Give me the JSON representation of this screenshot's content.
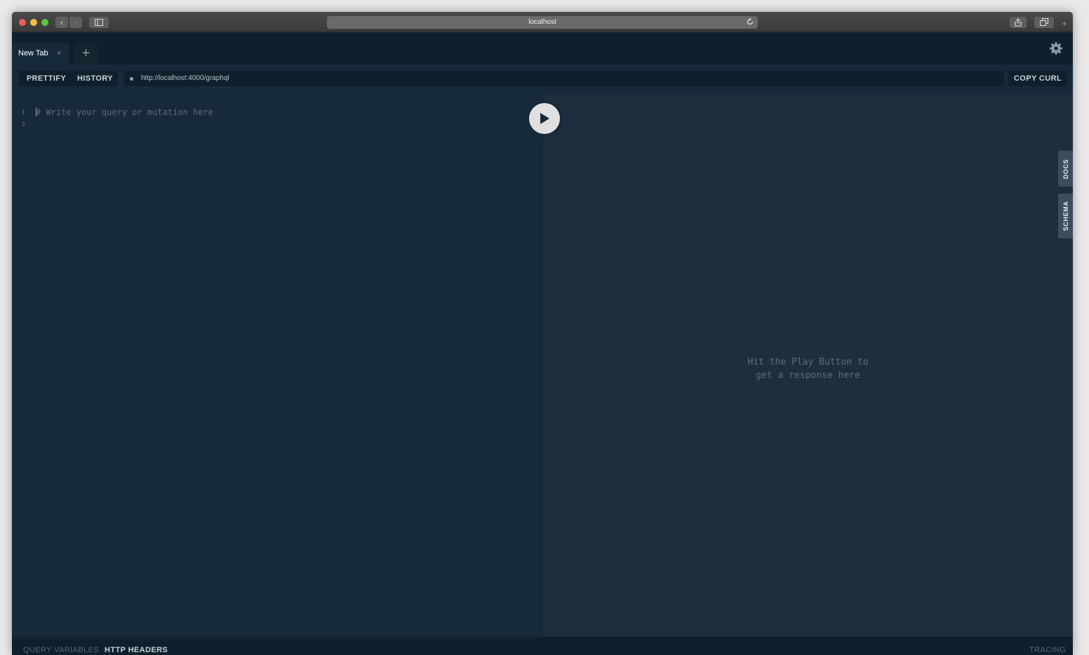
{
  "browser": {
    "address": "localhost"
  },
  "playground": {
    "tabs": [
      {
        "label": "New Tab",
        "close": "×"
      }
    ],
    "add_tab": "+",
    "toolbar": {
      "prettify": "PRETTIFY",
      "history": "HISTORY",
      "endpoint": "http://localhost:4000/graphql",
      "copy_curl": "COPY CURL"
    },
    "editor": {
      "line_numbers": [
        "1",
        "2"
      ],
      "placeholder": "# Write your query or mutation here"
    },
    "result": {
      "line1": "Hit the Play Button to",
      "line2": "get a response here"
    },
    "side_tabs": {
      "docs": "DOCS",
      "schema": "SCHEMA"
    },
    "bottom": {
      "query_variables": "QUERY VARIABLES",
      "http_headers": "HTTP HEADERS",
      "tracing": "TRACING"
    }
  },
  "colors": {
    "editor_bg": "#172a3a",
    "result_bg": "#1f2e3c",
    "tabbar_bg": "#0f202d"
  }
}
